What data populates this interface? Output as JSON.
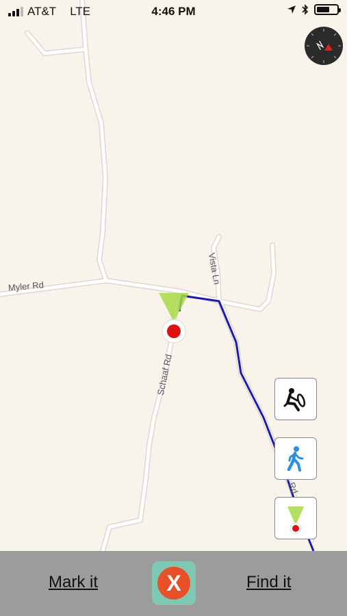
{
  "status_bar": {
    "carrier": "AT&T",
    "network": "LTE",
    "time": "4:46 PM",
    "icons": [
      "signal-bars-icon",
      "location-arrow-icon",
      "bluetooth-icon",
      "battery-icon"
    ]
  },
  "map": {
    "road_labels": {
      "myler": "Myler Rd",
      "vista": "Vista Ln",
      "schaaf": "Schaaf Rd",
      "schaaf_partial": "Schaaf Rd"
    },
    "route_color": "#1a1ab0",
    "marker_color": "#e01010",
    "road_color": "#ffffff"
  },
  "controls": {
    "compass_icon": "compass-icon",
    "mode_buttons": [
      "driving-mode-icon",
      "walking-mode-icon",
      "marked-location-icon"
    ]
  },
  "bottom_bar": {
    "mark_label": "Mark it",
    "find_label": "Find it",
    "logo_letter": "X",
    "logo_bg": "#7fc9b4",
    "logo_circle": "#e8502a"
  }
}
